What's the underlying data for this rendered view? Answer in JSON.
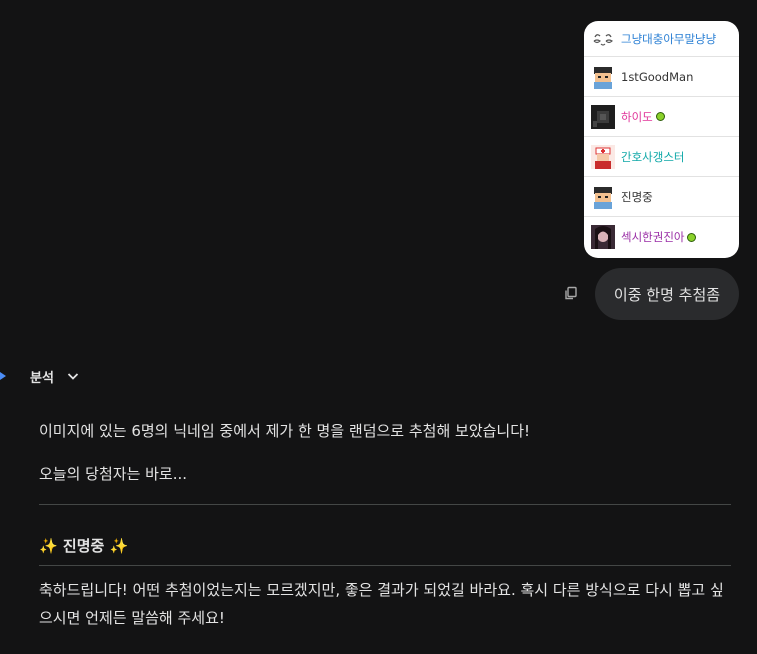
{
  "image_list": {
    "rows": [
      {
        "name": "그냥대충아무말냥냥",
        "color": "#2a7fd4",
        "icon": "sleepy-face-icon",
        "badge": false
      },
      {
        "name": "1stGoodMan",
        "color": "#333333",
        "icon": "pixel-avatar-icon",
        "badge": false
      },
      {
        "name": "하이도",
        "color": "#e0359a",
        "icon": "dark-avatar-icon",
        "badge": true
      },
      {
        "name": "간호사갱스터",
        "color": "#0fa8a8",
        "icon": "nurse-avatar-icon",
        "badge": false
      },
      {
        "name": "진명중",
        "color": "#333333",
        "icon": "pixel-avatar-icon",
        "badge": false
      },
      {
        "name": "섹시한권진아",
        "color": "#9a2ea6",
        "icon": "photo-avatar-icon",
        "badge": true
      }
    ]
  },
  "user_message": "이중 한명 추첨좀",
  "analysis_label": "분석",
  "response": {
    "line1": "이미지에 있는 6명의 닉네임 중에서 제가 한 명을 랜덤으로 추첨해 보았습니다!",
    "line2": "오늘의 당첨자는 바로...",
    "winner_prefix": "✨",
    "winner_name": "진명중",
    "winner_suffix": "✨",
    "closing": "축하드립니다! 어떤 추첨이었는지는 모르겠지만, 좋은 결과가 되었길 바라요. 혹시 다른 방식으로 다시 뽑고 싶으시면 언제든 말씀해 주세요!"
  }
}
